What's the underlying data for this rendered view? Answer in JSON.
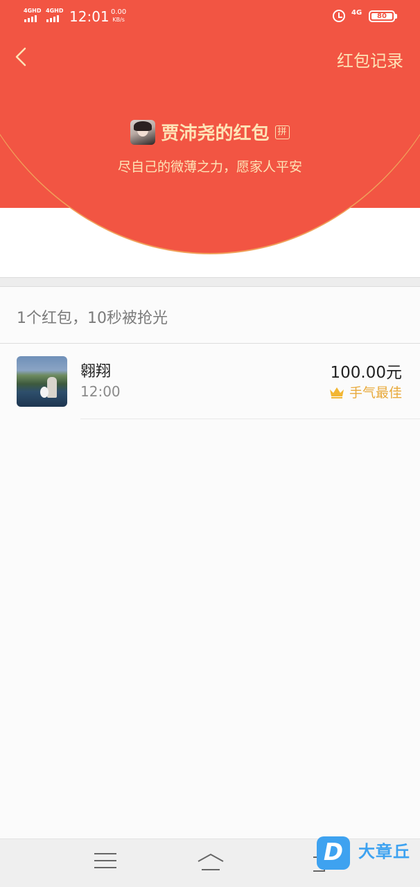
{
  "status_bar": {
    "sim1_label": "4GHD",
    "sim2_label": "4GHD",
    "time": "12:01",
    "speed_value": "0.00",
    "speed_unit": "KB/s",
    "network": "4G",
    "battery": "80"
  },
  "header": {
    "records_link": "红包记录",
    "sender_name": "贾沛尧的红包",
    "pin_badge": "拼",
    "greeting": "尽自己的微薄之力，愿家人平安"
  },
  "summary": "1个红包，10秒被抢光",
  "recipients": [
    {
      "name": "翱翔",
      "time": "12:00",
      "amount": "100.00元",
      "badge": "手气最佳"
    }
  ],
  "watermark": {
    "letter": "D",
    "text": "大章丘"
  },
  "colors": {
    "header_red": "#f25543",
    "gold_text": "#fde3b6",
    "best_luck": "#e8a93a"
  }
}
